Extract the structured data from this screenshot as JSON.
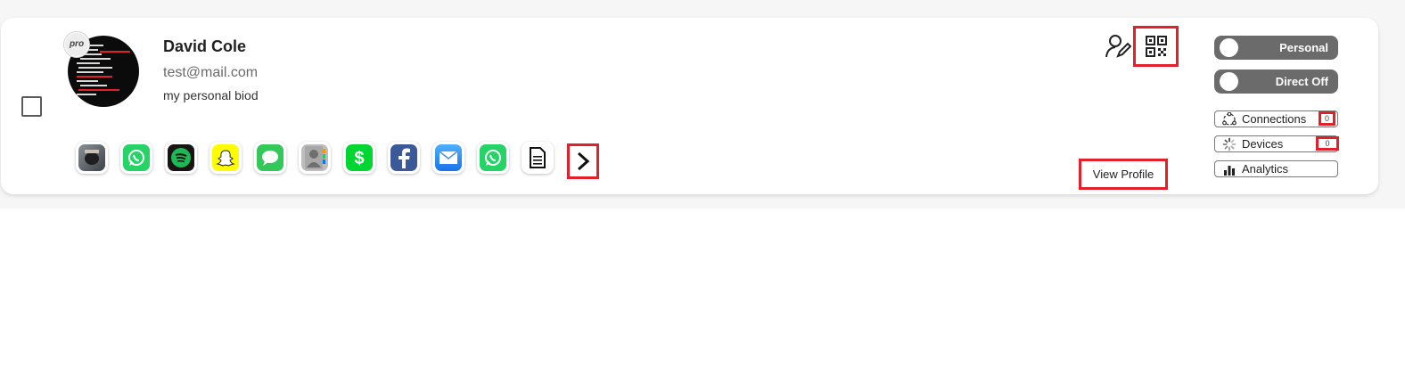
{
  "profile": {
    "name": "David Cole",
    "email": "test@mail.com",
    "bio": "my personal biod",
    "badge": "pro"
  },
  "apps": [
    {
      "icon": "photo-app-icon",
      "color": "#6b7a8a"
    },
    {
      "icon": "whatsapp-icon",
      "color": "#25d366"
    },
    {
      "icon": "spotify-icon",
      "color": "#191414"
    },
    {
      "icon": "snapchat-icon",
      "color": "#fffc00"
    },
    {
      "icon": "messages-icon",
      "color": "#34c759"
    },
    {
      "icon": "contacts-icon",
      "color": "#9e9e9e"
    },
    {
      "icon": "cashapp-icon",
      "color": "#00d632"
    },
    {
      "icon": "facebook-icon",
      "color": "#3b5998"
    },
    {
      "icon": "mail-icon",
      "color": "#1e90ff"
    },
    {
      "icon": "whatsapp-icon",
      "color": "#25d366"
    },
    {
      "icon": "document-icon",
      "color": "#ffffff"
    }
  ],
  "toggles": {
    "personal": "Personal",
    "direct": "Direct Off"
  },
  "stats": {
    "connections_label": "Connections",
    "connections_count": "0",
    "devices_label": "Devices",
    "devices_count": "0",
    "analytics_label": "Analytics"
  },
  "actions": {
    "view_profile": "View Profile"
  },
  "colors": {
    "highlight": "#e3202a",
    "toggle_bg": "#6b6b6b"
  }
}
